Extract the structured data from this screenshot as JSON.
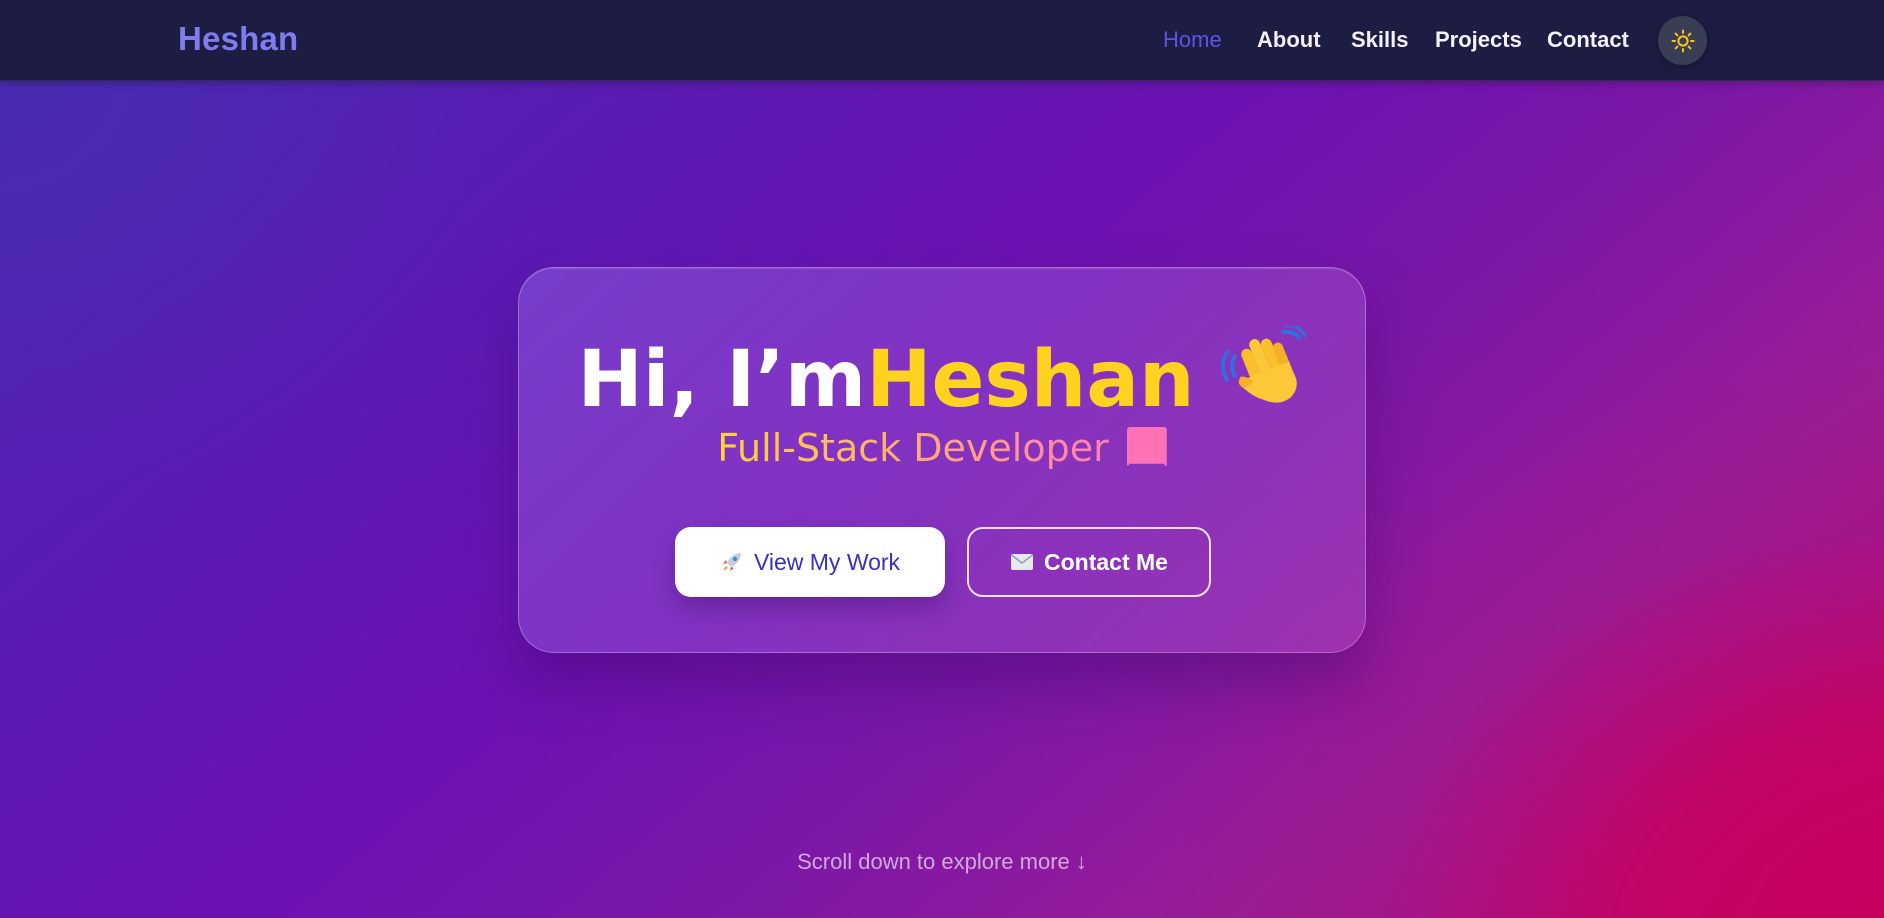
{
  "nav": {
    "brand": "Heshan",
    "links": [
      {
        "label": "Home",
        "active": true
      },
      {
        "label": "About",
        "active": false
      },
      {
        "label": "Skills",
        "active": false
      },
      {
        "label": "Projects",
        "active": false
      },
      {
        "label": "Contact",
        "active": false
      }
    ],
    "theme_toggle_icon": "sun-icon"
  },
  "hero": {
    "greeting": "Hi, I’m ",
    "name": "Heshan",
    "wave_icon": "waving-hand-icon",
    "subtitle": "Full-Stack Developer",
    "cursor_icon": "typing-cursor-block",
    "buttons": {
      "primary": {
        "icon": "rocket-icon",
        "label": "View My Work"
      },
      "secondary": {
        "icon": "envelope-icon",
        "label": "Contact Me"
      }
    }
  },
  "scroll_hint": "Scroll down to explore more ↓",
  "colors": {
    "nav_bg": "#1d1d44",
    "brand": "#7f7cf0",
    "nav_active": "#5b54ea",
    "name_highlight": "#ffd21f",
    "primary_button_text": "#3b2ec0",
    "toggle_bg": "#3a3e55",
    "sun": "#ffc21a"
  }
}
